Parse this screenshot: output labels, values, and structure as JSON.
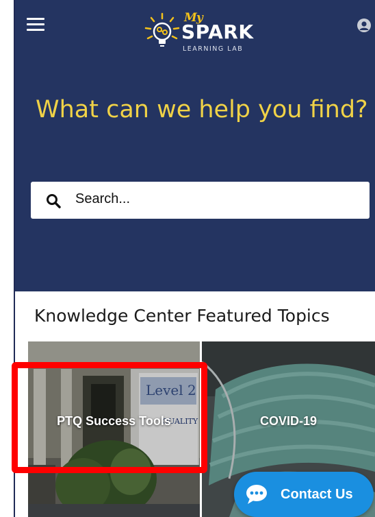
{
  "header": {
    "menu_icon": "hamburger-menu-icon",
    "avatar_icon": "user-avatar-icon",
    "logo": {
      "my": "My",
      "spark": "SPARK",
      "subtitle": "LEARNING LAB"
    }
  },
  "hero": {
    "headline": "What can we help you find?"
  },
  "search": {
    "placeholder": "Search...",
    "icon": "search-icon"
  },
  "featured": {
    "title": "Knowledge Center Featured Topics",
    "tiles": [
      {
        "label": "PTQ Success Tools",
        "sign_text": "Level 2",
        "sign_sub": "QUALITY"
      },
      {
        "label": "COVID-19"
      }
    ]
  },
  "contact": {
    "label": "Contact Us",
    "icon": "chat-bubble-icon"
  },
  "colors": {
    "hero_bg": "#243461",
    "headline": "#f0d247",
    "accent_blue": "#1a8fe0",
    "highlight_red": "#ff0000",
    "logo_yellow": "#f4c21b"
  }
}
